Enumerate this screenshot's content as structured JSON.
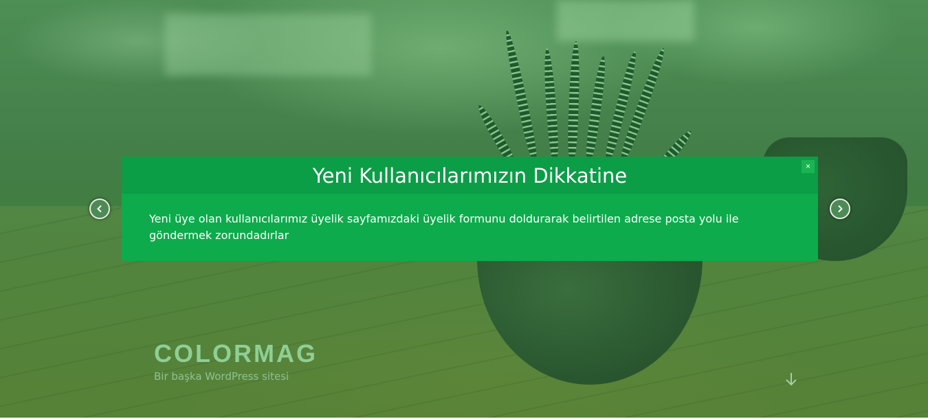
{
  "modal": {
    "title": "Yeni Kullanıcılarımızın Dikkatine",
    "close_label": "×",
    "body": "Yeni üye olan kullanıcılarımız üyelik sayfamızdaki üyelik formunu doldurarak belirtilen adrese posta yolu ile göndermek zorundadırlar"
  },
  "slider": {
    "prev_icon": "chevron-left-icon",
    "next_icon": "chevron-right-icon"
  },
  "site": {
    "title": "COLORMAG",
    "tagline": "Bir başka WordPress sitesi"
  },
  "scroll": {
    "icon": "arrow-down-icon"
  },
  "colors": {
    "modal_body": "#0dab4b",
    "modal_header": "#0c9d47",
    "overlay_green": "#3f7d3c"
  }
}
